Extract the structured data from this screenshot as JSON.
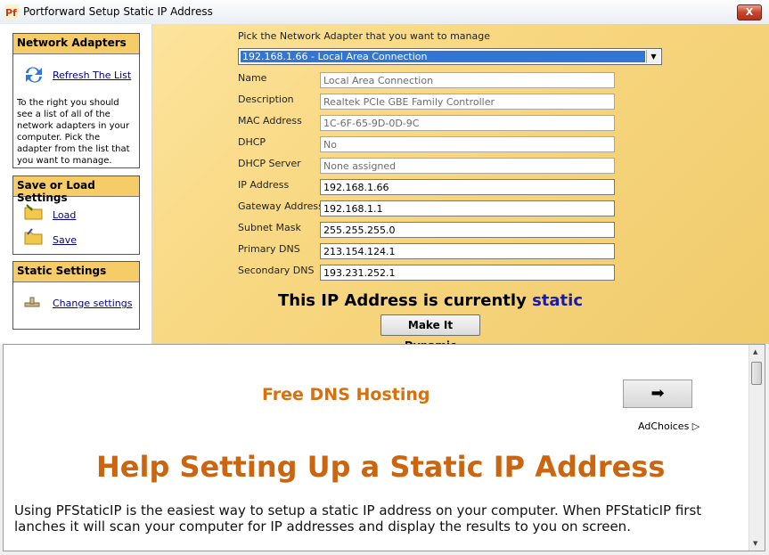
{
  "window": {
    "title": "Portforward Setup Static IP Address",
    "close": "X"
  },
  "sidebar": {
    "adapters": {
      "header": "Network Adapters",
      "refresh": "Refresh The List",
      "description": "To the right you should see a list of all of the network adapters in your computer. Pick the adapter from the list that you want to manage."
    },
    "saveload": {
      "header": "Save or Load Settings",
      "load": "Load",
      "save": "Save"
    },
    "static": {
      "header": "Static Settings",
      "change": "Change settings"
    }
  },
  "main": {
    "pick_label": "Pick the Network Adapter that you want to manage",
    "selected_adapter": "192.168.1.66 - Local Area Connection",
    "fields": [
      {
        "label": "Name",
        "value": "Local Area Connection"
      },
      {
        "label": "Description",
        "value": "Realtek PCIe GBE Family Controller"
      },
      {
        "label": "MAC Address",
        "value": "1C-6F-65-9D-0D-9C"
      },
      {
        "label": "DHCP",
        "value": "No"
      },
      {
        "label": "DHCP Server",
        "value": "None assigned"
      },
      {
        "label": "IP Address",
        "value": "192.168.1.66"
      },
      {
        "label": "Gateway Address",
        "value": "192.168.1.1"
      },
      {
        "label": "Subnet Mask",
        "value": "255.255.255.0"
      },
      {
        "label": "Primary DNS",
        "value": "213.154.124.1"
      },
      {
        "label": "Secondary DNS",
        "value": "193.231.252.1"
      }
    ],
    "status_prefix": "This IP Address is currently",
    "status_value": "static",
    "dynamic_button": "Make It Dynamic"
  },
  "web": {
    "ad_title": "Free DNS Hosting",
    "ad_button": "➡",
    "adchoices": "AdChoices ▷",
    "help_title": "Help Setting Up a Static IP Address",
    "help_text": "Using PFStaticIP is the easiest way to setup a static IP address on your computer. When PFStaticIP first lanches it will scan your computer for IP addresses and display the results to you on screen."
  },
  "colors": {
    "accent": "#f6cc68",
    "status": "#1a1aa8",
    "help_title": "#cc650f",
    "ad_title": "#d9700e"
  }
}
